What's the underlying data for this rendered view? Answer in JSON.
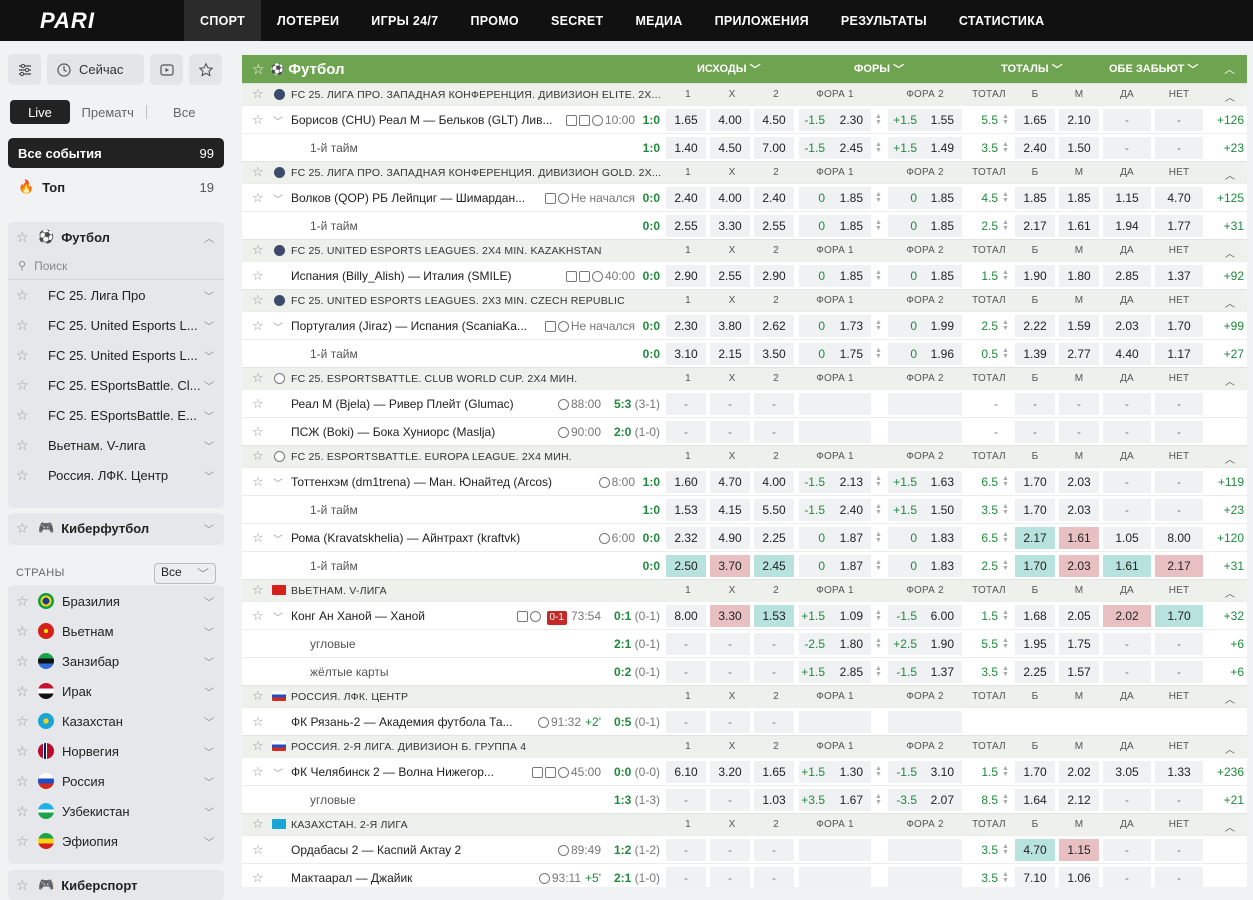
{
  "nav": {
    "logo": "PARI",
    "items": [
      "СПОРТ",
      "ЛОТЕРЕИ",
      "ИГРЫ 24/7",
      "ПРОМО",
      "SECRET",
      "МЕДИА",
      "ПРИЛОЖЕНИЯ",
      "РЕЗУЛЬТАТЫ",
      "СТАТИСТИКА"
    ],
    "active": "СПОРТ"
  },
  "sidebar": {
    "now_label": "Сейчас",
    "seg": {
      "live": "Live",
      "pre": "Прематч",
      "all": "Все"
    },
    "all_events": {
      "label": "Все события",
      "count": "99"
    },
    "top": {
      "label": "Топ",
      "count": "19"
    },
    "football": {
      "label": "Футбол",
      "search": "Поиск"
    },
    "leagues": [
      "FC 25. Лига Про",
      "FC 25. United Esports L...",
      "FC 25. United Esports L...",
      "FC 25. ESportsBattle. Cl...",
      "FC 25. ESportsBattle. E...",
      "Вьетнам. V-лига",
      "Россия. ЛФК. Центр"
    ],
    "cyberfootball": "Киберфутбол",
    "countries_label": "СТРАНЫ",
    "countries_filter": "Все",
    "countries": [
      "Бразилия",
      "Вьетнам",
      "Занзибар",
      "Ирак",
      "Казахстан",
      "Норвегия",
      "Россия",
      "Узбекистан",
      "Эфиопия"
    ],
    "cybersport": "Киберспорт"
  },
  "main": {
    "sport": "Футбол",
    "head_cols": {
      "outcomes": "ИСХОДЫ",
      "handicaps": "ФОРЫ",
      "totals": "ТОТАЛЫ",
      "both": "ОБЕ ЗАБЬЮТ"
    },
    "cols": [
      "1",
      "X",
      "2",
      "ФОРА 1",
      "ФОРА 2",
      "ТОТАЛ",
      "Б",
      "М",
      "ДА",
      "НЕТ"
    ],
    "leagues": [
      {
        "name": "FC 25. ЛИГА ПРО. ЗАПАДНАЯ КОНФЕРЕНЦИЯ. ДИВИЗИОН ELITE. 2X...",
        "icon": "trophy",
        "rows": [
          {
            "name": "Борисов (CHU) Реал М — Бельков (GLT) Лив...",
            "meta": "10:00",
            "score": "1:0",
            "odds": [
              "1.65",
              "4.00",
              "4.50"
            ],
            "f1": [
              "-1.5",
              "2.30"
            ],
            "f2": [
              "+1.5",
              "1.55"
            ],
            "t": "5.5",
            "tb": [
              "1.65",
              "2.10"
            ],
            "bt": [
              "-",
              "-"
            ],
            "more": "+126",
            "expand": true,
            "icons": 3
          },
          {
            "sub": "1-й тайм",
            "score": "1:0",
            "odds": [
              "1.40",
              "4.50",
              "7.00"
            ],
            "f1": [
              "-1.5",
              "2.45"
            ],
            "f2": [
              "+1.5",
              "1.49"
            ],
            "t": "3.5",
            "tb": [
              "2.40",
              "1.50"
            ],
            "bt": [
              "-",
              "-"
            ],
            "more": "+23"
          }
        ]
      },
      {
        "name": "FC 25. ЛИГА ПРО. ЗАПАДНАЯ КОНФЕРЕНЦИЯ. ДИВИЗИОН GOLD. 2X...",
        "icon": "trophy",
        "rows": [
          {
            "name": "Волков (QOP) РБ Лейпциг — Шимардан...",
            "meta": "Не начался",
            "score": "0:0",
            "odds": [
              "2.40",
              "4.00",
              "2.40"
            ],
            "f1": [
              "0",
              "1.85"
            ],
            "f2": [
              "0",
              "1.85"
            ],
            "t": "4.5",
            "tb": [
              "1.85",
              "1.85"
            ],
            "bt": [
              "1.15",
              "4.70"
            ],
            "more": "+125",
            "expand": true,
            "icons": 2
          },
          {
            "sub": "1-й тайм",
            "score": "0:0",
            "odds": [
              "2.55",
              "3.30",
              "2.55"
            ],
            "f1": [
              "0",
              "1.85"
            ],
            "f2": [
              "0",
              "1.85"
            ],
            "t": "2.5",
            "tb": [
              "2.17",
              "1.61"
            ],
            "bt": [
              "1.94",
              "1.77"
            ],
            "more": "+31"
          }
        ]
      },
      {
        "name": "FC 25. UNITED ESPORTS LEAGUES. 2X4 MIN. KAZAKHSTAN",
        "icon": "trophy",
        "rows": [
          {
            "name": "Испания (Billy_Alish) — Италия (SMILE)",
            "meta": "40:00",
            "score": "0:0",
            "odds": [
              "2.90",
              "2.55",
              "2.90"
            ],
            "f1": [
              "0",
              "1.85"
            ],
            "f2": [
              "0",
              "1.85"
            ],
            "t": "1.5",
            "tb": [
              "1.90",
              "1.80"
            ],
            "bt": [
              "2.85",
              "1.37"
            ],
            "more": "+92",
            "icons": 3
          }
        ]
      },
      {
        "name": "FC 25. UNITED ESPORTS LEAGUES. 2X3 MIN. CZECH REPUBLIC",
        "icon": "trophy",
        "rows": [
          {
            "name": "Португалия (Jiraz) — Испания (ScaniaKa...",
            "meta": "Не начался",
            "score": "0:0",
            "odds": [
              "2.30",
              "3.80",
              "2.62"
            ],
            "f1": [
              "0",
              "1.73"
            ],
            "f2": [
              "0",
              "1.99"
            ],
            "t": "2.5",
            "tb": [
              "2.22",
              "1.59"
            ],
            "bt": [
              "2.03",
              "1.70"
            ],
            "more": "+99",
            "expand": true,
            "icons": 2
          },
          {
            "sub": "1-й тайм",
            "score": "0:0",
            "odds": [
              "3.10",
              "2.15",
              "3.50"
            ],
            "f1": [
              "0",
              "1.75"
            ],
            "f2": [
              "0",
              "1.96"
            ],
            "t": "0.5",
            "tb": [
              "1.39",
              "2.77"
            ],
            "bt": [
              "4.40",
              "1.17"
            ],
            "more": "+27"
          }
        ]
      },
      {
        "name": "FC 25. ESPORTSBATTLE. CLUB WORLD CUP. 2X4 МИН.",
        "icon": "ea",
        "rows": [
          {
            "name": "Реал М (Bjela) — Ривер Плейт (Glumac)",
            "meta": "88:00",
            "score": "5:3",
            "score2": "(3-1)",
            "odds": [
              "-",
              "-",
              "-"
            ],
            "f1": [
              "",
              ""
            ],
            "f2": [
              "",
              ""
            ],
            "t": "-",
            "tb": [
              "-",
              "-"
            ],
            "bt": [
              "-",
              "-"
            ],
            "more": "",
            "icons": 1,
            "blank": true
          },
          {
            "name": "ПСЖ (Boki) — Бока Хуниорс (Maslja)",
            "meta": "90:00",
            "score": "2:0",
            "score2": "(1-0)",
            "odds": [
              "-",
              "-",
              "-"
            ],
            "f1": [
              "",
              ""
            ],
            "f2": [
              "",
              ""
            ],
            "t": "-",
            "tb": [
              "-",
              "-"
            ],
            "bt": [
              "-",
              "-"
            ],
            "more": "",
            "icons": 1,
            "blank": true
          }
        ]
      },
      {
        "name": "FC 25. ESPORTSBATTLE. EUROPA LEAGUE. 2X4 МИН.",
        "icon": "ea",
        "rows": [
          {
            "name": "Тоттенхэм (dm1trena) — Ман. Юнайтед (Arcos)",
            "meta": "8:00",
            "score": "1:0",
            "odds": [
              "1.60",
              "4.70",
              "4.00"
            ],
            "f1": [
              "-1.5",
              "2.13"
            ],
            "f2": [
              "+1.5",
              "1.63"
            ],
            "t": "6.5",
            "tb": [
              "1.70",
              "2.03"
            ],
            "bt": [
              "-",
              "-"
            ],
            "more": "+119",
            "expand": true,
            "icons": 1
          },
          {
            "sub": "1-й тайм",
            "score": "1:0",
            "odds": [
              "1.53",
              "4.15",
              "5.50"
            ],
            "f1": [
              "-1.5",
              "2.40"
            ],
            "f2": [
              "+1.5",
              "1.50"
            ],
            "t": "3.5",
            "tb": [
              "1.70",
              "2.03"
            ],
            "bt": [
              "-",
              "-"
            ],
            "more": "+23"
          },
          {
            "name": "Рома (Kravatskhelia) — Айнтрахт (kraftvk)",
            "meta": "6:00",
            "score": "0:0",
            "odds": [
              "2.32",
              "4.90",
              "2.25"
            ],
            "f1": [
              "0",
              "1.87"
            ],
            "f2": [
              "0",
              "1.83"
            ],
            "t": "6.5",
            "tb": [
              "2.17",
              "1.61"
            ],
            "bt": [
              "1.05",
              "8.00"
            ],
            "more": "+120",
            "expand": true,
            "icons": 1,
            "hl": {
              "tb0": "up",
              "tb1": "dn"
            }
          },
          {
            "sub": "1-й тайм",
            "score": "0:0",
            "odds": [
              "2.50",
              "3.70",
              "2.45"
            ],
            "f1": [
              "0",
              "1.87"
            ],
            "f2": [
              "0",
              "1.83"
            ],
            "t": "2.5",
            "tb": [
              "1.70",
              "2.03"
            ],
            "bt": [
              "1.61",
              "2.17"
            ],
            "more": "+31",
            "hl": {
              "o0": "up",
              "o1": "dn",
              "o2": "up",
              "tb0": "up",
              "tb1": "dn",
              "bt0": "up",
              "bt1": "dn"
            }
          }
        ]
      },
      {
        "name": "ВЬЕТНАМ. V-ЛИГА",
        "icon": "vn",
        "rows": [
          {
            "name": "Конг Ан Ханой — Ханой",
            "meta": "73:54",
            "badge": "0-1",
            "score": "0:1",
            "score2": "(0-1)",
            "odds": [
              "8.00",
              "3.30",
              "1.53"
            ],
            "f1": [
              "+1.5",
              "1.09"
            ],
            "f2": [
              "-1.5",
              "6.00"
            ],
            "t": "1.5",
            "tb": [
              "1.68",
              "2.05"
            ],
            "bt": [
              "2.02",
              "1.70"
            ],
            "more": "+32",
            "expand": true,
            "icons": 2,
            "hl": {
              "o1": "dn",
              "o2": "up",
              "bt0": "dn",
              "bt1": "up"
            }
          },
          {
            "sub": "угловые",
            "score": "2:1",
            "score2": "(0-1)",
            "odds": [
              "-",
              "-",
              "-"
            ],
            "f1": [
              "-2.5",
              "1.80"
            ],
            "f2": [
              "+2.5",
              "1.90"
            ],
            "t": "5.5",
            "tb": [
              "1.95",
              "1.75"
            ],
            "bt": [
              "-",
              "-"
            ],
            "more": "+6"
          },
          {
            "sub": "жёлтые карты",
            "score": "0:2",
            "score2": "(0-1)",
            "odds": [
              "-",
              "-",
              "-"
            ],
            "f1": [
              "+1.5",
              "2.85"
            ],
            "f2": [
              "-1.5",
              "1.37"
            ],
            "t": "3.5",
            "tb": [
              "2.25",
              "1.57"
            ],
            "bt": [
              "-",
              "-"
            ],
            "more": "+6"
          }
        ]
      },
      {
        "name": "РОССИЯ. ЛФК. ЦЕНТР",
        "icon": "ru",
        "rows": [
          {
            "name": "ФК Рязань-2 — Академия футбола Та...",
            "meta": "91:32",
            "extra": "+2'",
            "score": "0:5",
            "score2": "(0-1)",
            "odds": [
              "-",
              "-",
              "-"
            ],
            "f1": [
              "",
              ""
            ],
            "f2": [
              "",
              ""
            ],
            "t": "",
            "tb": [
              "",
              ""
            ],
            "bt": [
              "",
              ""
            ],
            "more": "",
            "icons": 1,
            "blank": true,
            "emptyright": true
          }
        ]
      },
      {
        "name": "РОССИЯ. 2-Я ЛИГА. ДИВИЗИОН Б. ГРУППА 4",
        "icon": "ru",
        "rows": [
          {
            "name": "ФК Челябинск 2 — Волна Нижегор...",
            "meta": "45:00",
            "score": "0:0",
            "score2": "(0-0)",
            "odds": [
              "6.10",
              "3.20",
              "1.65"
            ],
            "f1": [
              "+1.5",
              "1.30"
            ],
            "f2": [
              "-1.5",
              "3.10"
            ],
            "t": "1.5",
            "tb": [
              "1.70",
              "2.02"
            ],
            "bt": [
              "3.05",
              "1.33"
            ],
            "more": "+236",
            "expand": true,
            "icons": 3
          },
          {
            "sub": "угловые",
            "score": "1:3",
            "score2": "(1-3)",
            "odds": [
              "-",
              "-",
              "1.03"
            ],
            "f1": [
              "+3.5",
              "1.67"
            ],
            "f2": [
              "-3.5",
              "2.07"
            ],
            "t": "8.5",
            "tb": [
              "1.64",
              "2.12"
            ],
            "bt": [
              "-",
              "-"
            ],
            "more": "+21"
          }
        ]
      },
      {
        "name": "КАЗАХСТАН. 2-Я ЛИГА",
        "icon": "kz",
        "rows": [
          {
            "name": "Ордабасы 2 — Каспий Актау 2",
            "meta": "89:49",
            "score": "1:2",
            "score2": "(1-2)",
            "odds": [
              "-",
              "-",
              "-"
            ],
            "f1": [
              "",
              ""
            ],
            "f2": [
              "",
              ""
            ],
            "t": "3.5",
            "tb": [
              "4.70",
              "1.15"
            ],
            "bt": [
              "-",
              "-"
            ],
            "more": "",
            "icons": 1,
            "blank": true,
            "hl": {
              "tb0": "up",
              "tb1": "dn"
            }
          },
          {
            "name": "Мактаарал — Джайик",
            "meta": "93:11",
            "extra": "+5'",
            "score": "2:1",
            "score2": "(1-0)",
            "odds": [
              "-",
              "-",
              "-"
            ],
            "f1": [
              "",
              ""
            ],
            "f2": [
              "",
              ""
            ],
            "t": "3.5",
            "tb": [
              "7.10",
              "1.06"
            ],
            "bt": [
              "-",
              "-"
            ],
            "more": "",
            "icons": 1,
            "blank": true
          }
        ]
      }
    ]
  }
}
